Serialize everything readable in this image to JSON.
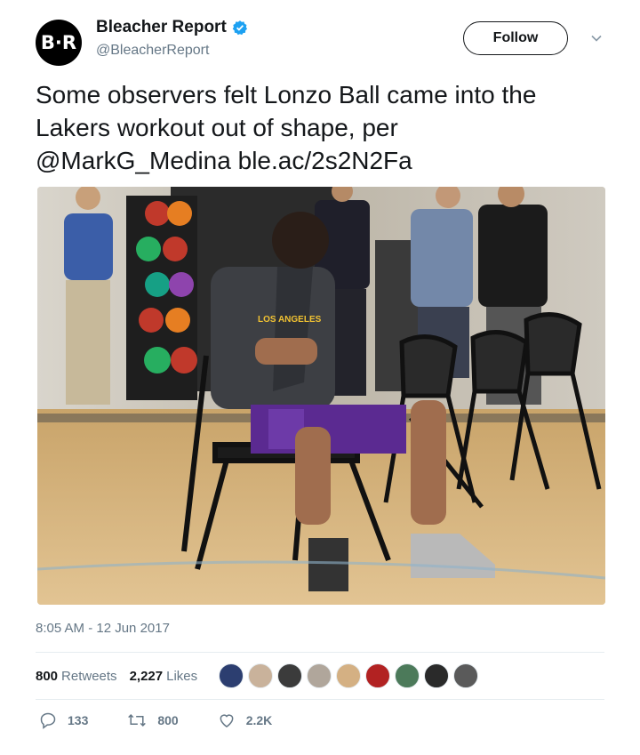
{
  "account": {
    "avatar_text": "B·R",
    "display_name": "Bleacher Report",
    "handle": "@BleacherReport",
    "follow_label": "Follow"
  },
  "tweet": {
    "text_line1": "Some observers felt Lonzo Ball came into the",
    "text_line2": "Lakers workout out of shape, per",
    "mention": "@MarkG_Medina",
    "link": "ble.ac/2s2N2Fa",
    "timestamp": "8:05 AM - 12 Jun 2017"
  },
  "stats": {
    "retweets_count": "800",
    "retweets_label": "Retweets",
    "likes_count": "2,227",
    "likes_label": "Likes"
  },
  "actions": {
    "reply_count": "133",
    "retweet_count": "800",
    "like_count": "2.2K"
  },
  "photo": {
    "shirt_text": "LOS ANGELES"
  },
  "colors": {
    "accent": "#1da1f2",
    "text": "#14171a",
    "muted": "#657786",
    "shorts": "#5b2a91"
  },
  "icons": [
    "verified-badge-icon",
    "chevron-down-icon",
    "reply-icon",
    "retweet-icon",
    "like-icon"
  ]
}
